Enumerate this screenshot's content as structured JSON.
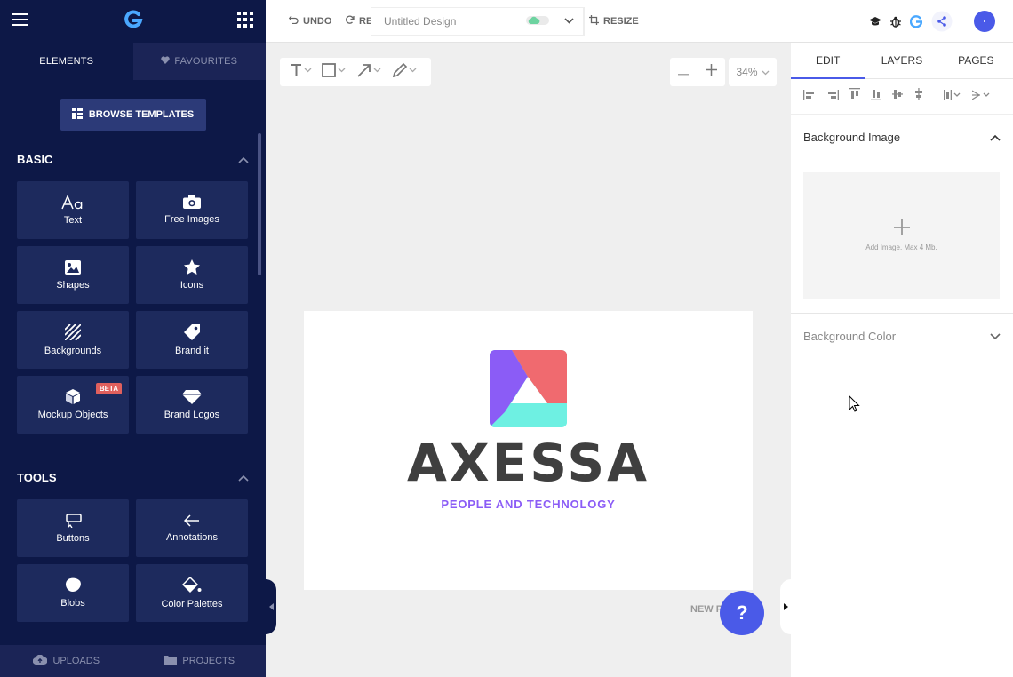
{
  "sidebar": {
    "tabs": [
      {
        "label": "ELEMENTS"
      },
      {
        "label": "FAVOURITES"
      }
    ],
    "browse_templates": "BROWSE TEMPLATES",
    "sections": [
      {
        "title": "BASIC",
        "items": [
          {
            "label": "Text",
            "icon": "text-icon"
          },
          {
            "label": "Free Images",
            "icon": "camera-icon"
          },
          {
            "label": "Shapes",
            "icon": "image-icon"
          },
          {
            "label": "Icons",
            "icon": "star-icon"
          },
          {
            "label": "Backgrounds",
            "icon": "stripes-icon"
          },
          {
            "label": "Brand it",
            "icon": "tag-icon"
          },
          {
            "label": "Mockup Objects",
            "icon": "cube-icon",
            "badge": "BETA"
          },
          {
            "label": "Brand Logos",
            "icon": "diamond-icon"
          }
        ]
      },
      {
        "title": "TOOLS",
        "items": [
          {
            "label": "Buttons",
            "icon": "button-icon"
          },
          {
            "label": "Annotations",
            "icon": "arrow-left-icon"
          },
          {
            "label": "Blobs",
            "icon": "blob-icon"
          },
          {
            "label": "Color Palettes",
            "icon": "paint-bucket-icon"
          }
        ]
      }
    ],
    "bottom": [
      {
        "label": "UPLOADS",
        "icon": "cloud-upload-icon"
      },
      {
        "label": "PROJECTS",
        "icon": "folder-icon"
      }
    ]
  },
  "topbar": {
    "undo": "UNDO",
    "redo": "REDO",
    "design_name": "Untitled Design",
    "resize": "RESIZE"
  },
  "canvas": {
    "zoom": "34%",
    "brand": "AXESSA",
    "tagline": "PEOPLE AND TECHNOLOGY",
    "new_page": "NEW PAGE",
    "help": "?"
  },
  "right_panel": {
    "tabs": [
      "EDIT",
      "LAYERS",
      "PAGES"
    ],
    "background_image": "Background Image",
    "upload_hint": "Add Image. Max 4 Mb.",
    "background_color": "Background Color"
  },
  "colors": {
    "sidebar_bg": "#0d1847",
    "tile_bg": "#1d2a5d",
    "accent": "#4a5ae8",
    "tagline": "#8b5cf6",
    "logo_purple": "#8b5cf6",
    "logo_red": "#f06a6f",
    "logo_cyan": "#6ef0e2"
  }
}
